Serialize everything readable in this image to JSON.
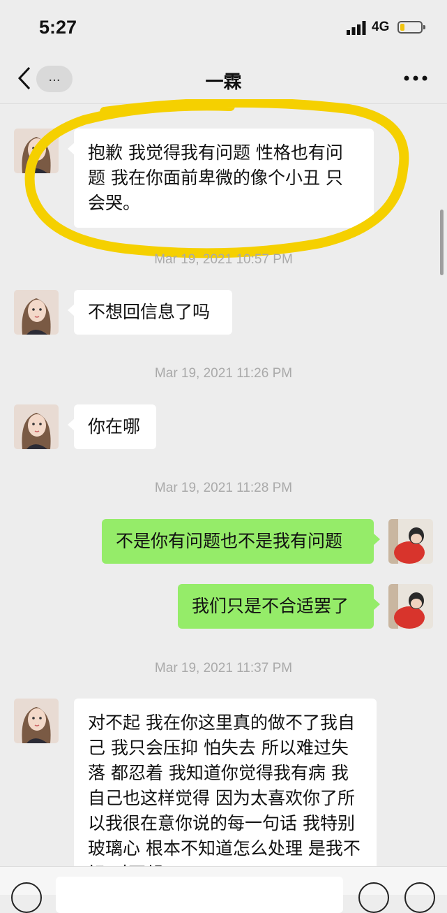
{
  "status": {
    "time": "5:27",
    "network": "4G"
  },
  "nav": {
    "more_label": "...",
    "title": "一霖"
  },
  "messages": [
    {
      "side": "in",
      "text": "抱歉 我觉得我有问题 性格也有问题 我在你面前卑微的像个小丑 只会哭。"
    },
    {
      "timestamp": "Mar 19, 2021 10:57 PM"
    },
    {
      "side": "in",
      "text": "不想回信息了吗"
    },
    {
      "timestamp": "Mar 19, 2021 11:26 PM"
    },
    {
      "side": "in",
      "text": "你在哪"
    },
    {
      "timestamp": "Mar 19, 2021 11:28 PM"
    },
    {
      "side": "out",
      "text": "不是你有问题也不是我有问题"
    },
    {
      "side": "out",
      "text": "我们只是不合适罢了"
    },
    {
      "timestamp": "Mar 19, 2021 11:37 PM"
    },
    {
      "side": "in",
      "text": "对不起 我在你这里真的做不了我自己 我只会压抑 怕失去 所以难过失落 都忍着 我知道你觉得我有病 我自己也这样觉得 因为太喜欢你了所以我很在意你说的每一句话 我特别玻璃心 根本不知道怎么处理 是我不好 对不起"
    }
  ],
  "colors": {
    "incoming_bubble": "#ffffff",
    "outgoing_bubble": "#95ec69",
    "highlight": "#f5d000",
    "background": "#ededed"
  }
}
